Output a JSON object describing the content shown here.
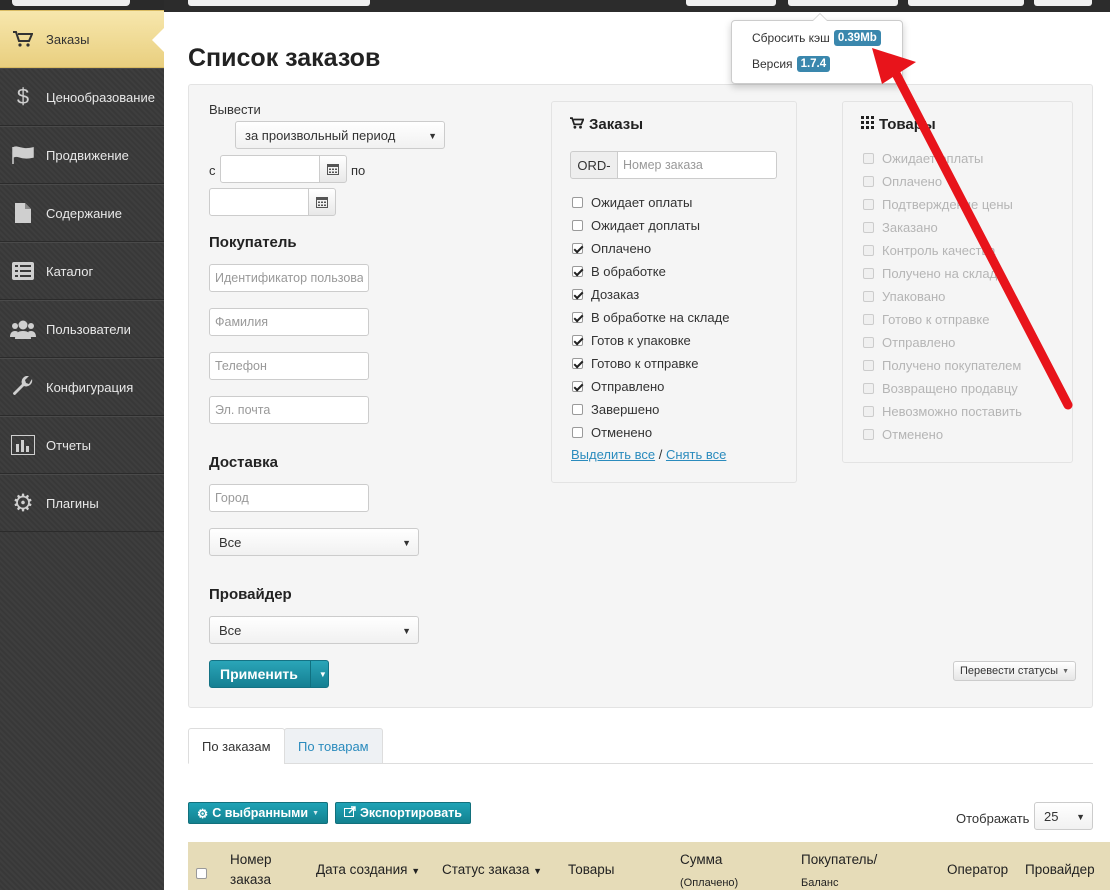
{
  "sidebar": {
    "items": [
      {
        "label": "Заказы",
        "icon": "cart-icon",
        "active": true
      },
      {
        "label": "Ценообразование",
        "icon": "dollar-icon"
      },
      {
        "label": "Продвижение",
        "icon": "flag-icon"
      },
      {
        "label": "Содержание",
        "icon": "document-icon"
      },
      {
        "label": "Каталог",
        "icon": "catalog-icon"
      },
      {
        "label": "Пользователи",
        "icon": "users-icon"
      },
      {
        "label": "Конфигурация",
        "icon": "wrench-icon"
      },
      {
        "label": "Отчеты",
        "icon": "chart-icon"
      },
      {
        "label": "Плагины",
        "icon": "gear-icon"
      }
    ]
  },
  "popover": {
    "cache_label": "Сбросить кэш",
    "cache_value": "0.39Mb",
    "version_label": "Версия",
    "version_value": "1.7.4"
  },
  "page_title": "Список заказов",
  "filters": {
    "period_label": "Вывести",
    "period_value": "за произвольный период",
    "from_label": "с",
    "to_label": "по",
    "buyer_title": "Покупатель",
    "buyer_id_placeholder": "Идентификатор пользователя",
    "surname_placeholder": "Фамилия",
    "phone_placeholder": "Телефон",
    "email_placeholder": "Эл. почта",
    "delivery_title": "Доставка",
    "city_placeholder": "Город",
    "delivery_value": "Все",
    "provider_title": "Провайдер",
    "provider_value": "Все",
    "apply_label": "Применить",
    "change_status_label": "Перевести статусы"
  },
  "orders_box": {
    "title": "Заказы",
    "prefix": "ORD-",
    "number_placeholder": "Номер заказа",
    "statuses": [
      {
        "label": "Ожидает оплаты",
        "checked": false
      },
      {
        "label": "Ожидает доплаты",
        "checked": false
      },
      {
        "label": "Оплачено",
        "checked": true
      },
      {
        "label": "В обработке",
        "checked": true
      },
      {
        "label": "Дозаказ",
        "checked": true
      },
      {
        "label": "В обработке на складе",
        "checked": true
      },
      {
        "label": "Готов к упаковке",
        "checked": true
      },
      {
        "label": "Готово к отправке",
        "checked": true
      },
      {
        "label": "Отправлено",
        "checked": true
      },
      {
        "label": "Завершено",
        "checked": false
      },
      {
        "label": "Отменено",
        "checked": false
      }
    ],
    "select_all": "Выделить все",
    "separator": "/",
    "deselect_all": "Снять все"
  },
  "goods_box": {
    "title": "Товары",
    "statuses": [
      "Ожидает оплаты",
      "Оплачено",
      "Подтверждение цены",
      "Заказано",
      "Контроль качества",
      "Получено на складе",
      "Упаковано",
      "Готово к отправке",
      "Отправлено",
      "Получено покупателем",
      "Возвращено продавцу",
      "Невозможно поставить",
      "Отменено"
    ]
  },
  "tabs": [
    {
      "label": "По заказам",
      "active": true
    },
    {
      "label": "По товарам",
      "active": false
    }
  ],
  "actions": {
    "with_selected": "С выбранными",
    "export": "Экспортировать",
    "per_page_label": "Отображать",
    "per_page_value": "25"
  },
  "table": {
    "headers": {
      "number": "Номер",
      "number2": "заказа",
      "created": "Дата создания",
      "status": "Статус заказа",
      "goods": "Товары",
      "sum": "Сумма",
      "sum2": "(Оплачено)",
      "buyer": "Покупатель/",
      "buyer2": "Баланс",
      "operator": "Оператор",
      "provider": "Провайдер"
    }
  },
  "colors": {
    "accent": "#1a8ea2",
    "badge": "#3a87ad",
    "arrow": "#e8141b",
    "active_nav": "#f2dc94",
    "table_header": "#e6dcb8"
  }
}
